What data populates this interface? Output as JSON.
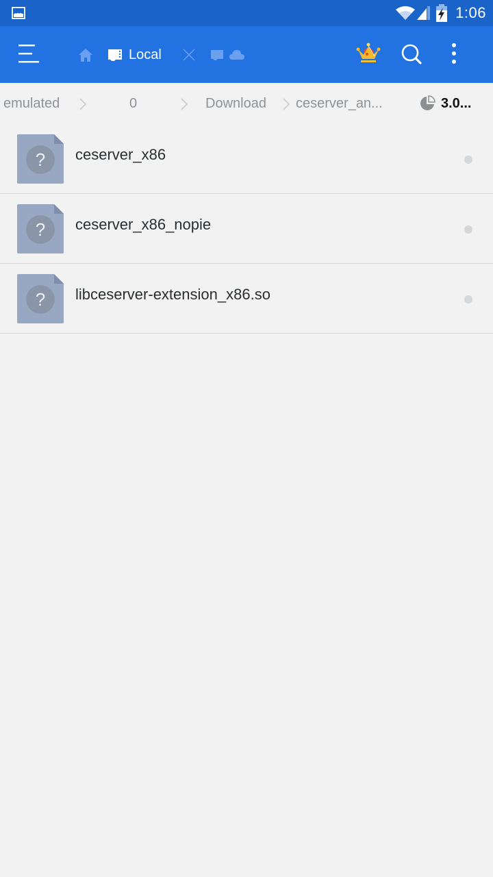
{
  "status_bar": {
    "time": "1:06",
    "icons": [
      "gallery-notification-icon",
      "wifi-icon",
      "cell-signal-icon",
      "battery-charging-icon"
    ]
  },
  "app_bar": {
    "tabs": [
      {
        "icon": "home-icon",
        "label": ""
      },
      {
        "icon": "sd-card-icon",
        "label": "Local",
        "active": true
      },
      {
        "icon": "close-icon",
        "label": ""
      },
      {
        "icon": "storage-icon",
        "label": ""
      },
      {
        "icon": "cloud-icon",
        "label": ""
      }
    ],
    "actions": [
      "premium-crown-icon",
      "search-icon",
      "more-vert-icon"
    ],
    "colors": {
      "bar": "#2272e2",
      "status": "#1a63c8"
    }
  },
  "breadcrumb": {
    "items": [
      "emulated",
      "0",
      "Download",
      "ceserver_an..."
    ],
    "storage_value": "3.0..."
  },
  "files": [
    {
      "name": "ceserver_x86",
      "icon": "unknown-file-icon"
    },
    {
      "name": "ceserver_x86_nopie",
      "icon": "unknown-file-icon"
    },
    {
      "name": "libceserver-extension_x86.so",
      "icon": "unknown-file-icon"
    }
  ]
}
